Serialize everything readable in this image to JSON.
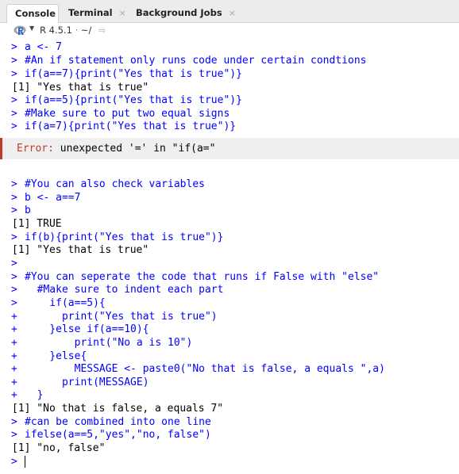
{
  "tabs": [
    {
      "label": "Console",
      "active": true
    },
    {
      "label": "Terminal",
      "close": "×"
    },
    {
      "label": "Background Jobs",
      "close": "×"
    }
  ],
  "pathbar": {
    "r_version": "R 4.5.1",
    "separator": "·",
    "path": "~/"
  },
  "console_lines": [
    {
      "type": "in",
      "prompt": ">",
      "text": "a <- 7"
    },
    {
      "type": "in",
      "prompt": ">",
      "text": "#An if statement only runs code under certain condtions"
    },
    {
      "type": "in",
      "prompt": ">",
      "text": "if(a==7){print(\"Yes that is true\")}"
    },
    {
      "type": "out",
      "text": "[1] \"Yes that is true\""
    },
    {
      "type": "in",
      "prompt": ">",
      "text": "if(a==5){print(\"Yes that is true\")}"
    },
    {
      "type": "in",
      "prompt": ">",
      "text": "#Make sure to put two equal signs"
    },
    {
      "type": "in",
      "prompt": ">",
      "text": "if(a=7){print(\"Yes that is true\")}"
    }
  ],
  "error": {
    "label": "Error:",
    "message": " unexpected '=' in \"if(a=\""
  },
  "console_lines_2": [
    {
      "type": "in",
      "prompt": ">",
      "text": "#You can also check variables"
    },
    {
      "type": "in",
      "prompt": ">",
      "text": "b <- a==7"
    },
    {
      "type": "in",
      "prompt": ">",
      "text": "b"
    },
    {
      "type": "out",
      "text": "[1] TRUE"
    },
    {
      "type": "in",
      "prompt": ">",
      "text": "if(b){print(\"Yes that is true\")}"
    },
    {
      "type": "out",
      "text": "[1] \"Yes that is true\""
    },
    {
      "type": "in",
      "prompt": ">",
      "text": ""
    },
    {
      "type": "in",
      "prompt": ">",
      "text": "#You can seperate the code that runs if False with \"else\""
    },
    {
      "type": "in",
      "prompt": ">",
      "text": "  #Make sure to indent each part"
    },
    {
      "type": "in",
      "prompt": ">",
      "text": "    if(a==5){"
    },
    {
      "type": "in",
      "prompt": "+",
      "text": "      print(\"Yes that is true\")"
    },
    {
      "type": "in",
      "prompt": "+",
      "text": "    }else if(a==10){"
    },
    {
      "type": "in",
      "prompt": "+",
      "text": "        print(\"No a is 10\")"
    },
    {
      "type": "in",
      "prompt": "+",
      "text": "    }else{"
    },
    {
      "type": "in",
      "prompt": "+",
      "text": "        MESSAGE <- paste0(\"No that is false, a equals \",a)"
    },
    {
      "type": "in",
      "prompt": "+",
      "text": "      print(MESSAGE)"
    },
    {
      "type": "in",
      "prompt": "+",
      "text": "  }"
    },
    {
      "type": "out",
      "text": "[1] \"No that is false, a equals 7\""
    },
    {
      "type": "in",
      "prompt": ">",
      "text": "#can be combined into one line"
    },
    {
      "type": "in",
      "prompt": ">",
      "text": "ifelse(a==5,\"yes\",\"no, false\")"
    },
    {
      "type": "out",
      "text": "[1] \"no, false\""
    }
  ],
  "input_prompt": ">",
  "colors": {
    "input": "#0000ff",
    "output": "#000000",
    "error_label": "#c0392b",
    "error_bg": "#efefef"
  }
}
